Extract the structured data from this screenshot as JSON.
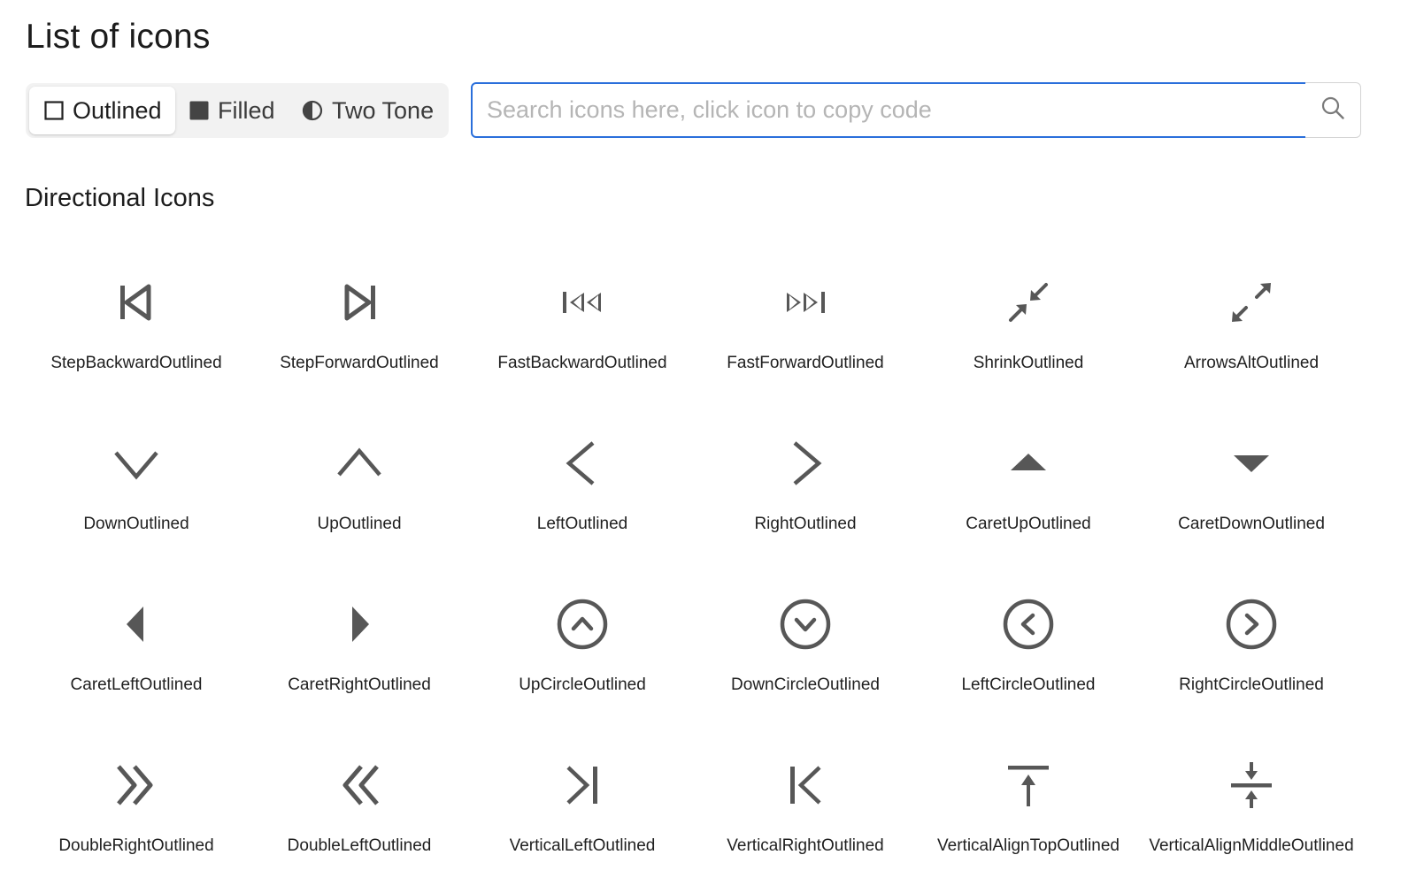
{
  "page": {
    "title": "List of icons"
  },
  "theme_toggle": {
    "selected": "Outlined",
    "options": [
      {
        "label": "Outlined",
        "icon": "square-outline-icon"
      },
      {
        "label": "Filled",
        "icon": "square-filled-icon"
      },
      {
        "label": "Two Tone",
        "icon": "half-circle-icon"
      }
    ]
  },
  "search": {
    "placeholder": "Search icons here, click icon to copy code",
    "value": "",
    "button_icon": "search-icon"
  },
  "section": {
    "title": "Directional Icons"
  },
  "colors": {
    "accent": "#2a6fdb",
    "icon": "#575757"
  },
  "icons": [
    {
      "label": "StepBackwardOutlined",
      "icon": "step-backward-icon"
    },
    {
      "label": "StepForwardOutlined",
      "icon": "step-forward-icon"
    },
    {
      "label": "FastBackwardOutlined",
      "icon": "fast-backward-icon"
    },
    {
      "label": "FastForwardOutlined",
      "icon": "fast-forward-icon"
    },
    {
      "label": "ShrinkOutlined",
      "icon": "shrink-icon"
    },
    {
      "label": "ArrowsAltOutlined",
      "icon": "arrows-alt-icon"
    },
    {
      "label": "DownOutlined",
      "icon": "down-icon"
    },
    {
      "label": "UpOutlined",
      "icon": "up-icon"
    },
    {
      "label": "LeftOutlined",
      "icon": "left-icon"
    },
    {
      "label": "RightOutlined",
      "icon": "right-icon"
    },
    {
      "label": "CaretUpOutlined",
      "icon": "caret-up-icon"
    },
    {
      "label": "CaretDownOutlined",
      "icon": "caret-down-icon"
    },
    {
      "label": "CaretLeftOutlined",
      "icon": "caret-left-icon"
    },
    {
      "label": "CaretRightOutlined",
      "icon": "caret-right-icon"
    },
    {
      "label": "UpCircleOutlined",
      "icon": "up-circle-icon"
    },
    {
      "label": "DownCircleOutlined",
      "icon": "down-circle-icon"
    },
    {
      "label": "LeftCircleOutlined",
      "icon": "left-circle-icon"
    },
    {
      "label": "RightCircleOutlined",
      "icon": "right-circle-icon"
    },
    {
      "label": "DoubleRightOutlined",
      "icon": "double-right-icon"
    },
    {
      "label": "DoubleLeftOutlined",
      "icon": "double-left-icon"
    },
    {
      "label": "VerticalLeftOutlined",
      "icon": "vertical-left-icon"
    },
    {
      "label": "VerticalRightOutlined",
      "icon": "vertical-right-icon"
    },
    {
      "label": "VerticalAlignTopOutlined",
      "icon": "vertical-align-top-icon"
    },
    {
      "label": "VerticalAlignMiddleOutlined",
      "icon": "vertical-align-middle-icon"
    }
  ]
}
